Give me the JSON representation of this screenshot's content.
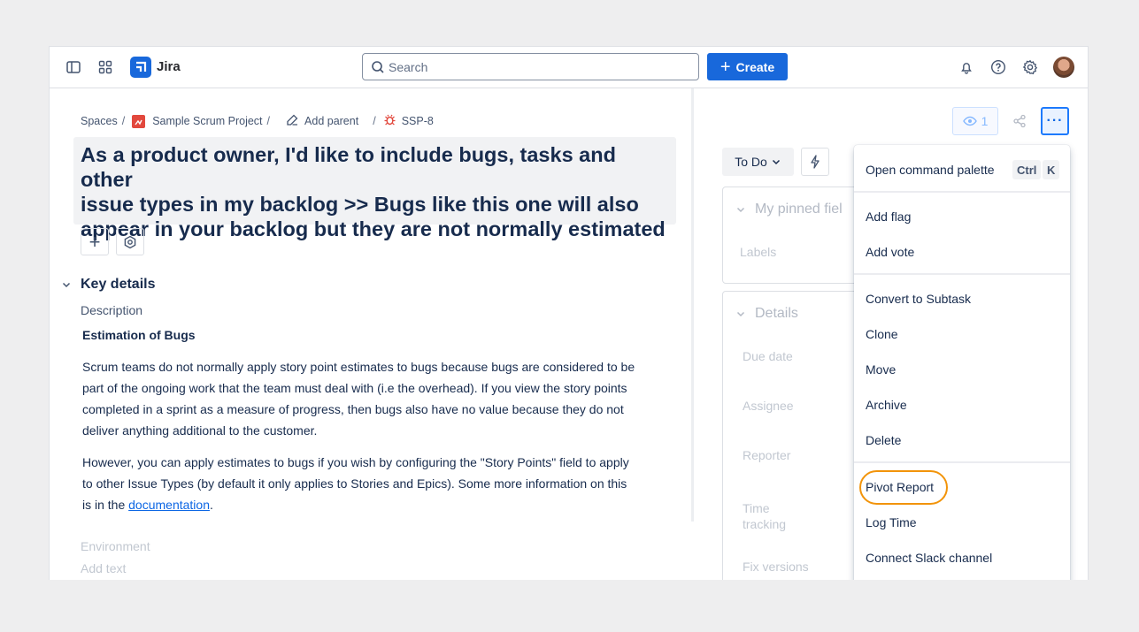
{
  "topbar": {
    "brand": "Jira",
    "search_placeholder": "Search",
    "create_label": "Create",
    "icons": [
      "sidebar-toggle-icon",
      "app-switcher-icon",
      "notifications-icon",
      "help-icon",
      "settings-icon"
    ]
  },
  "breadcrumb": {
    "spaces": "Spaces",
    "separator": "/",
    "project": "Sample Scrum Project",
    "add_parent": "Add parent",
    "issue_key": "SSP-8"
  },
  "issue": {
    "title_line1": "As a product owner, I'd like to include bugs, tasks and other",
    "title_line2": "issue types in my backlog >> Bugs like this one will also",
    "title_line3": "appear in your backlog but they are not normally estimated"
  },
  "key_details": {
    "heading": "Key details",
    "description_label": "Description",
    "subheading": "Estimation of Bugs",
    "para1_line1": "Scrum teams do not normally apply story point estimates to bugs because bugs are considered to be",
    "para1_line2": "part of the ongoing work that the team must deal with (i.e the overhead). If you view the story points",
    "para1_line3": "completed in a sprint as a measure of progress, then bugs also have no value because they do not",
    "para1_line4": "deliver anything additional to the customer.",
    "para2_line1": "However, you can apply estimates to bugs if you wish by configuring the \"Story Points\" field to apply",
    "para2_line2": "to other Issue Types (by default it only applies to Stories and Epics). Some more information on this",
    "para2_line3_prefix": "is in the ",
    "para2_link": "documentation",
    "para2_line3_suffix": ".",
    "environment_label": "Environment",
    "environment_placeholder": "Add text"
  },
  "right_panel": {
    "watch_count": "1",
    "status": "To Do",
    "pinned_heading": "My pinned fiel",
    "labels": "Labels",
    "details_heading": "Details",
    "due_date": "Due date",
    "assignee": "Assignee",
    "reporter": "Reporter",
    "time_tracking_1": "Time",
    "time_tracking_2": "tracking",
    "fix_versions": "Fix versions"
  },
  "menu": {
    "command_palette": "Open command palette",
    "shortcut_ctrl": "Ctrl",
    "shortcut_k": "K",
    "add_flag": "Add flag",
    "add_vote": "Add vote",
    "convert": "Convert to Subtask",
    "clone": "Clone",
    "move": "Move",
    "archive": "Archive",
    "delete": "Delete",
    "pivot_report": "Pivot Report",
    "log_time": "Log Time",
    "connect_slack": "Connect Slack channel"
  },
  "colors": {
    "brand_blue": "#1868db",
    "highlight_orange": "#f2940a",
    "bug_red": "#e2483d"
  }
}
